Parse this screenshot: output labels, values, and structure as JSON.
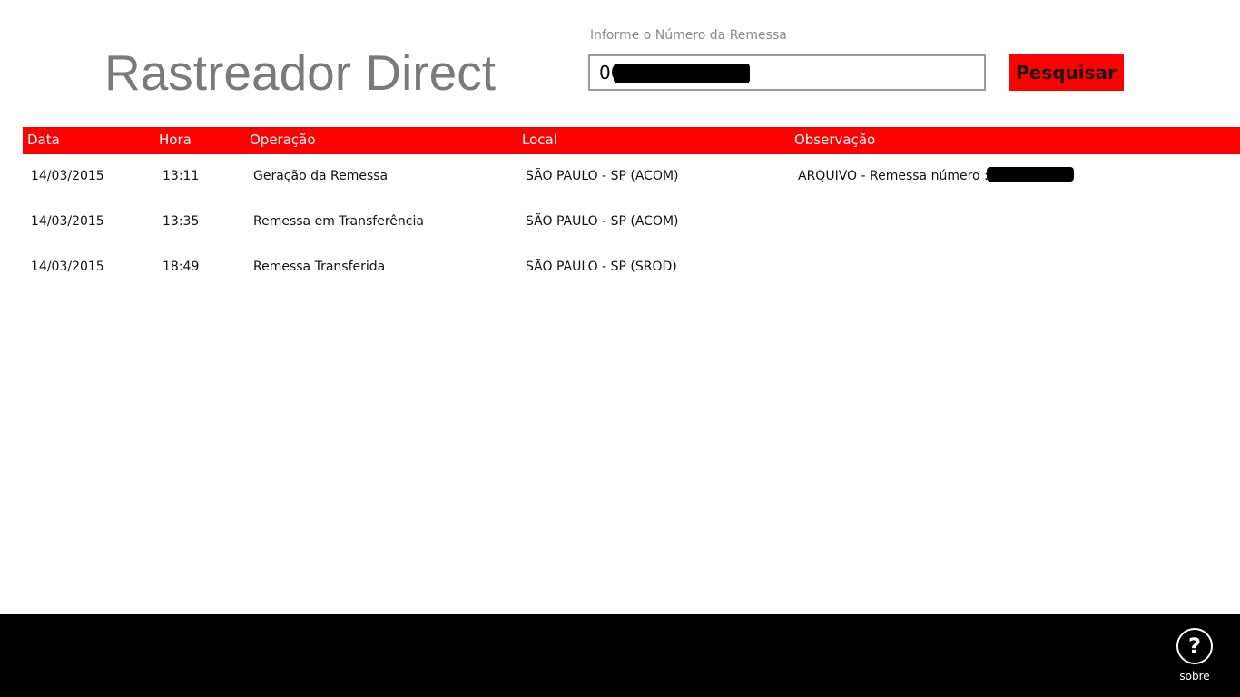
{
  "app": {
    "title": "Rastreador Direct"
  },
  "search": {
    "label": "Informe o Número da Remessa",
    "value": "00             9",
    "button_label": "Pesquisar"
  },
  "table": {
    "headers": {
      "data": "Data",
      "hora": "Hora",
      "operacao": "Operação",
      "local": "Local",
      "observacao": "Observação"
    },
    "rows": [
      {
        "data": "14/03/2015",
        "hora": "13:11",
        "operacao": "Geração da Remessa",
        "local": "SÃO PAULO - SP (ACOM)",
        "observacao": "ARQUIVO - Remessa número : 0               9"
      },
      {
        "data": "14/03/2015",
        "hora": "13:35",
        "operacao": "Remessa em Transferência",
        "local": "SÃO PAULO - SP (ACOM)",
        "observacao": ""
      },
      {
        "data": "14/03/2015",
        "hora": "18:49",
        "operacao": "Remessa Transferida",
        "local": "SÃO PAULO - SP (SROD)",
        "observacao": ""
      }
    ]
  },
  "app_bar": {
    "about_icon": "question-mark-circle-icon",
    "about_glyph": "?",
    "about_label": "sobre"
  },
  "colors": {
    "accent": "#ff0000",
    "app_bar": "#000000",
    "title_gray": "#7a7a7a"
  }
}
